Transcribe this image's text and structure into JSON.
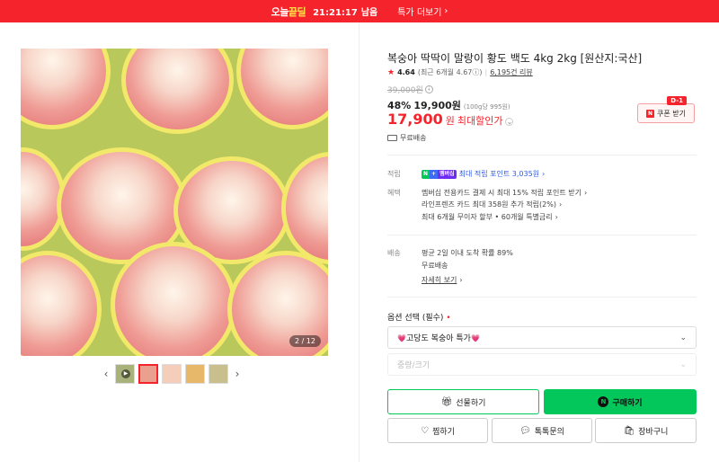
{
  "topbar": {
    "logo_left": "오늘",
    "logo_right": "끝딜",
    "timer": "21:21:17",
    "timer_suffix": "남음",
    "more_label": "특가 더보기",
    "more_arrow": "›"
  },
  "gallery": {
    "page_indicator": "2 / 12",
    "prev_arrow": "‹",
    "next_arrow": "›",
    "play_symbol": "▶"
  },
  "product": {
    "title": "복숭아 딱딱이 말랑이 황도 백도 4kg 2kg [원산지:국산]",
    "rating_star": "★",
    "rating_score": "4.64",
    "rating_recent": "(최근 6개월 4.67",
    "rating_recent_close": ")",
    "rating_info": "ⓘ",
    "rating_sep": "|",
    "reviews": "6,195건 리뷰",
    "original_price": "39,000원",
    "discount_rate": "48%",
    "discount_price": "19,900원",
    "unit_price": "(100g당 995원)",
    "final_price": "17,900",
    "final_won": "원",
    "final_label": "최대할인가",
    "final_chevron": "⌄",
    "coupon_label": "쿠폰 받기",
    "coupon_dday": "D-1",
    "coupon_n": "N",
    "shipping_free": "무료배송"
  },
  "benefits": {
    "points_label": "적립",
    "npay_a": "N",
    "npay_b": "+",
    "npay_c": "멤버십",
    "points_text": "최대 적립 포인트 3,035원",
    "points_arrow": "›",
    "benefit_label": "혜택",
    "benefit_lines": [
      "멤버십 전용카드 결제 시 최대 15% 적립 포인트 받기",
      "라인프렌즈 카드 최대 358원 추가 적립(2%)",
      "최대 6개월 무이자 할부 • 60개월 특별금리"
    ],
    "benefit_arrow": "›"
  },
  "delivery": {
    "label": "배송",
    "line1": "평균 2일 이내 도착 확률 89%",
    "line2": "무료배송",
    "details_link": "자세히 보기",
    "details_arrow": "›"
  },
  "options": {
    "label": "옵션 선택 (필수)",
    "required_mark": "•",
    "select1_heart": "💗",
    "select1_value": "고당도 복숭아 특가",
    "select2_placeholder": "중량/크기",
    "chevron": "⌄"
  },
  "actions": {
    "gift": "선물하기",
    "buy": "구매하기",
    "buy_n": "N",
    "zzim": "찜하기",
    "talk": "톡톡문의",
    "cart": "장바구니"
  },
  "colors": {
    "accent_red": "#f5242c",
    "naver_green": "#03c75a"
  }
}
